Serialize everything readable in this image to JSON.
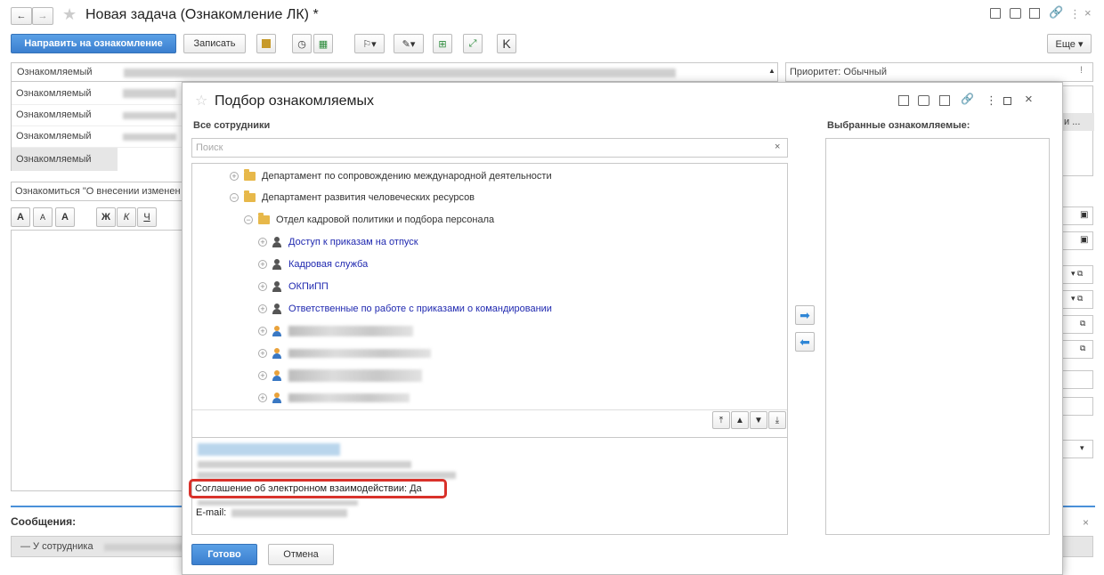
{
  "window": {
    "title": "Новая задача (Ознакомление ЛК) *",
    "more_label": "Еще ▾"
  },
  "toolbar": {
    "send_label": "Направить на ознакомление",
    "save_label": "Записать"
  },
  "main_form": {
    "row_labels": [
      "Ознакомляемый",
      "Ознакомляемый",
      "Ознакомляемый",
      "Ознакомляемый",
      "Ознакомляемый"
    ],
    "priority_label": "Приоритет: Обычный",
    "subject_text": "Ознакомиться \"О внесении изменен",
    "format_buttons": [
      "A",
      "A",
      "A",
      "Ж",
      "К",
      "Ч"
    ],
    "messages_header": "Сообщения:",
    "messages_item": "— У сотрудника",
    "right_trunc": "и ..."
  },
  "dialog": {
    "title": "Подбор ознакомляемых",
    "all_employees_label": "Все сотрудники",
    "selected_label": "Выбранные ознакомляемые:",
    "search_placeholder": "Поиск",
    "search_clear": "×",
    "tree": [
      {
        "text": "Департамент по сопровождению международной деятельности",
        "kind": "folder"
      },
      {
        "text": "Департамент развития человеческих ресурсов",
        "kind": "folder"
      },
      {
        "text": "Отдел кадровой политики и подбора персонала",
        "kind": "folder"
      },
      {
        "text": "Доступ к приказам на отпуск",
        "kind": "group"
      },
      {
        "text": "Кадровая служба",
        "kind": "group"
      },
      {
        "text": "ОКПиПП",
        "kind": "group"
      },
      {
        "text": "Ответственные по работе с приказами о командировании",
        "kind": "group"
      }
    ],
    "info": {
      "agreement_text": "Соглашение об электронном взаимодействии: Да",
      "email_label": "E-mail:"
    },
    "done_label": "Готово",
    "cancel_label": "Отмена",
    "highlight_color": "#d9312a",
    "accent_color": "#4a90d9"
  }
}
